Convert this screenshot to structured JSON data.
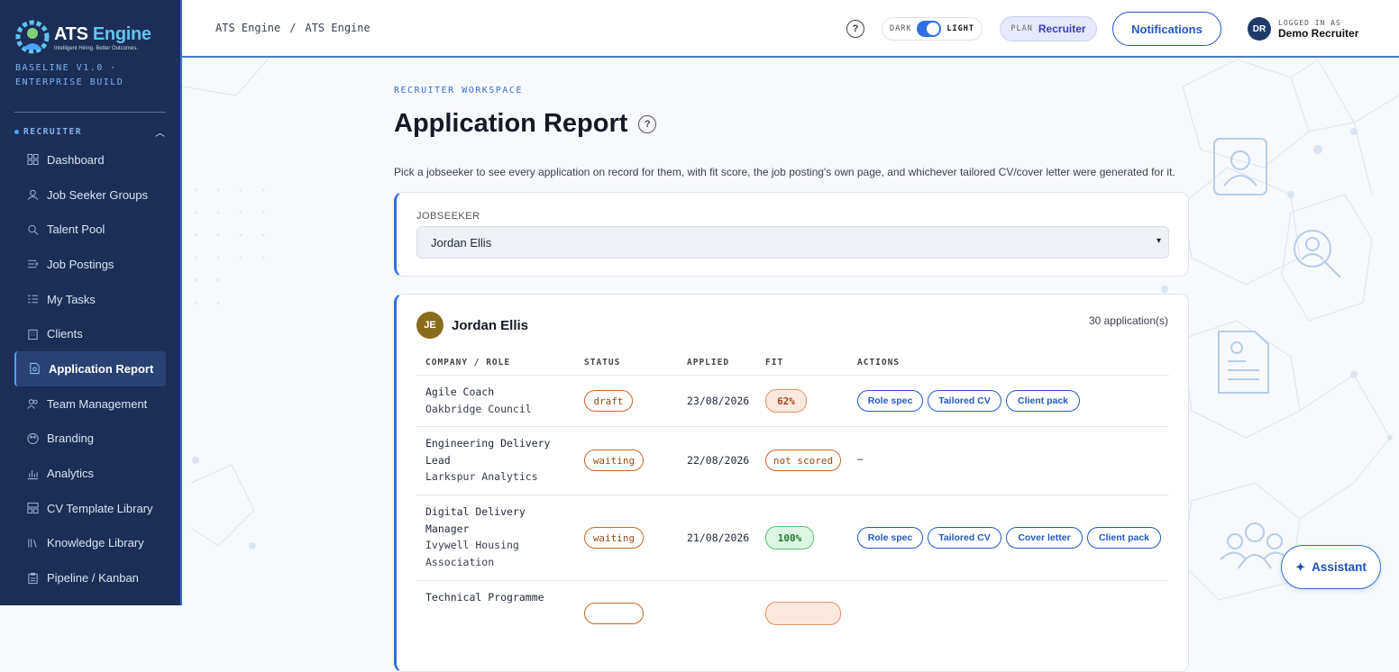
{
  "brand": {
    "name_a": "ATS ",
    "name_b": "Engine",
    "tagline": "Intelligent Hiring. Better Outcomes.",
    "build": "BASELINE V1.0 · ENTERPRISE BUILD"
  },
  "sidebar": {
    "section": "RECRUITER",
    "items": [
      {
        "label": "Dashboard",
        "icon": "dashboard-icon"
      },
      {
        "label": "Job Seeker Groups",
        "icon": "users-icon"
      },
      {
        "label": "Talent Pool",
        "icon": "search-icon"
      },
      {
        "label": "Job Postings",
        "icon": "list-arrow-icon"
      },
      {
        "label": "My Tasks",
        "icon": "checklist-icon"
      },
      {
        "label": "Clients",
        "icon": "building-icon"
      },
      {
        "label": "Application Report",
        "icon": "report-icon",
        "active": true
      },
      {
        "label": "Team Management",
        "icon": "team-icon"
      },
      {
        "label": "Branding",
        "icon": "palette-icon"
      },
      {
        "label": "Analytics",
        "icon": "bar-chart-icon"
      },
      {
        "label": "CV Template Library",
        "icon": "template-icon"
      },
      {
        "label": "Knowledge Library",
        "icon": "books-icon"
      },
      {
        "label": "Pipeline / Kanban",
        "icon": "clipboard-icon"
      }
    ]
  },
  "header": {
    "breadcrumb": [
      "ATS Engine",
      "ATS Engine"
    ],
    "breadcrumb_sep": "/",
    "theme_dark": "DARK",
    "theme_light": "LIGHT",
    "plan_label": "PLAN",
    "plan_value": "Recruiter",
    "notifications": "Notifications",
    "user_initials": "DR",
    "logged_in_as": "LOGGED IN AS",
    "user_name": "Demo Recruiter"
  },
  "page": {
    "eyebrow": "RECRUITER WORKSPACE",
    "title": "Application Report",
    "description": "Pick a jobseeker to see every application on record for them, with fit score, the job posting's own page, and whichever tailored CV/cover letter were generated for it.",
    "jobseeker_label": "JOBSEEKER",
    "jobseeker_selected": "Jordan Ellis"
  },
  "report": {
    "initials": "JE",
    "name": "Jordan Ellis",
    "count": "30 application(s)",
    "columns": [
      "COMPANY / ROLE",
      "STATUS",
      "APPLIED",
      "FIT",
      "ACTIONS"
    ],
    "rows": [
      {
        "role": "Agile Coach",
        "company": "Oakbridge Council",
        "status": "draft",
        "applied": "23/08/2026",
        "fit": "62%",
        "actions": [
          "Role spec",
          "Tailored CV",
          "Client pack"
        ]
      },
      {
        "role": "Engineering Delivery Lead",
        "company": "Larkspur Analytics",
        "status": "waiting",
        "applied": "22/08/2026",
        "fit": "not scored",
        "no_actions": "–"
      },
      {
        "role": "Digital Delivery Manager",
        "company": "Ivywell Housing Association",
        "status": "waiting",
        "applied": "21/08/2026",
        "fit": "100%",
        "actions": [
          "Role spec",
          "Tailored CV",
          "Cover letter",
          "Client pack"
        ]
      },
      {
        "role": "Technical Programme",
        "company": "",
        "status": "",
        "applied": "",
        "fit": ""
      }
    ]
  },
  "assistant": "Assistant",
  "colors": {
    "sidebar": "#1c2e57",
    "accent": "#2f6fe0",
    "fit_green": "#1f7a36",
    "fit_orange": "#a3461a"
  }
}
